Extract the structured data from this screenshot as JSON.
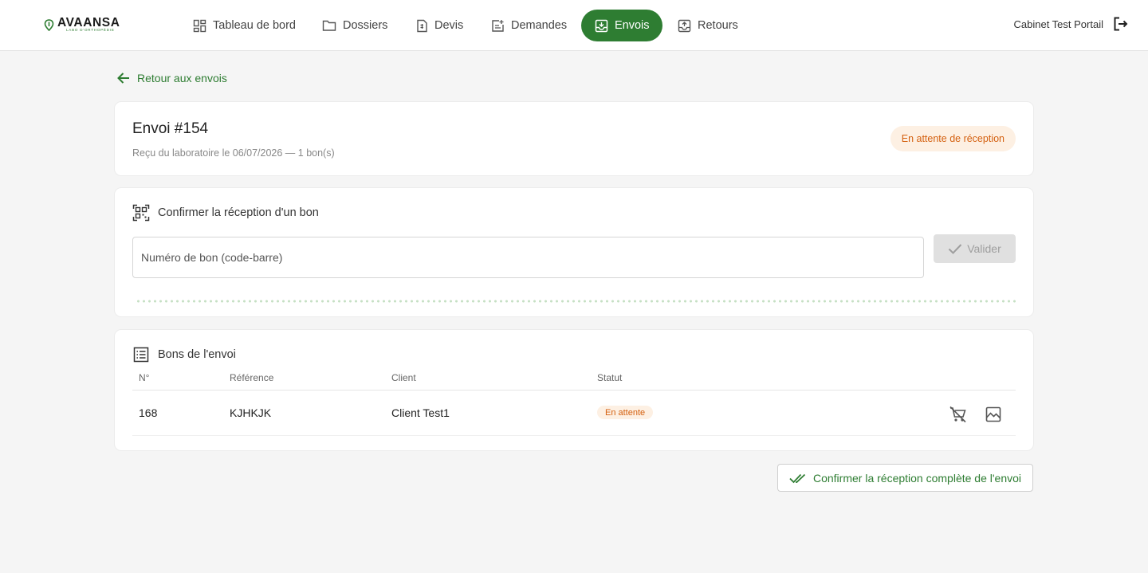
{
  "brand": {
    "name": "AVAANSA",
    "tagline": "LABO D'ORTHOPÉDIE",
    "accent": "#2e7d32"
  },
  "nav": {
    "items": [
      {
        "label": "Tableau de bord",
        "icon": "dashboard-icon",
        "active": false
      },
      {
        "label": "Dossiers",
        "icon": "folder-icon",
        "active": false
      },
      {
        "label": "Devis",
        "icon": "quote-document-icon",
        "active": false
      },
      {
        "label": "Demandes",
        "icon": "request-add-icon",
        "active": false
      },
      {
        "label": "Envois",
        "icon": "outbox-icon",
        "active": true
      },
      {
        "label": "Retours",
        "icon": "return-box-icon",
        "active": false
      }
    ]
  },
  "account": {
    "name": "Cabinet Test Portail",
    "logout_icon": "logout-icon"
  },
  "back_link": {
    "label": "Retour aux envois"
  },
  "shipment": {
    "title": "Envoi #154",
    "subtitle": "Reçu du laboratoire le 06/07/2026 — 1 bon(s)",
    "status": "En attente de réception"
  },
  "confirm_section": {
    "title": "Confirmer la réception d'un bon",
    "icon": "qr-scan-icon",
    "input_placeholder": "Numéro de bon (code-barre)",
    "input_value": "",
    "validate_label": "Valider"
  },
  "orders_section": {
    "title": "Bons de l'envoi",
    "icon": "list-icon",
    "columns": [
      "N°",
      "Référence",
      "Client",
      "Statut"
    ],
    "rows": [
      {
        "number": "168",
        "reference": "KJHKJK",
        "client": "Client Test1",
        "status": "En attente"
      }
    ]
  },
  "confirm_all_button": {
    "label": "Confirmer la réception complète de l'envoi"
  },
  "colors": {
    "status_bg": "#fdf0e3",
    "status_text": "#d4600f",
    "active_nav": "#2e7d32"
  }
}
